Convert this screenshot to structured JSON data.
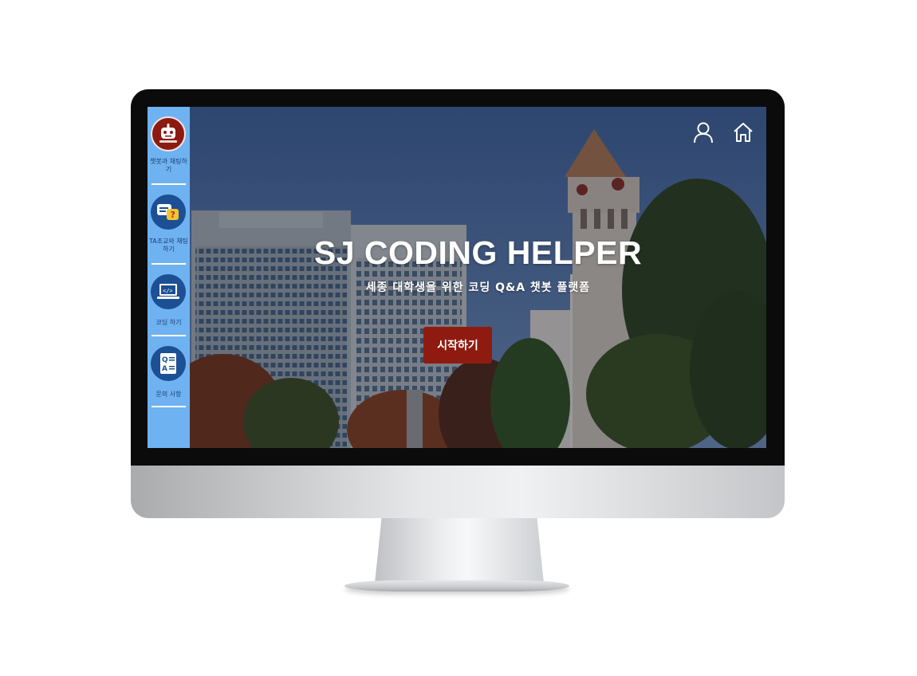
{
  "sidebar": {
    "logo_icon": "robot-mascot-logo",
    "items": [
      {
        "label": "챗봇과 채팅하기",
        "icon": "robot-chat-icon"
      },
      {
        "label": "TA조교와 채팅하기",
        "icon": "question-chat-icon"
      },
      {
        "label": "코딩 하기",
        "icon": "code-laptop-icon"
      },
      {
        "label": "문의 사항",
        "icon": "qa-document-icon"
      }
    ]
  },
  "header": {
    "profile_icon": "user-icon",
    "home_icon": "home-icon"
  },
  "hero": {
    "title": "SJ CODING HELPER",
    "subtitle": "세종 대학생을 위한 코딩 Q&A 챗봇 플랫폼",
    "start_button_label": "시작하기"
  },
  "colors": {
    "sidebar_bg": "#6fb2f1",
    "icon_circle": "#1c4f94",
    "accent_red": "#8f1b10"
  }
}
